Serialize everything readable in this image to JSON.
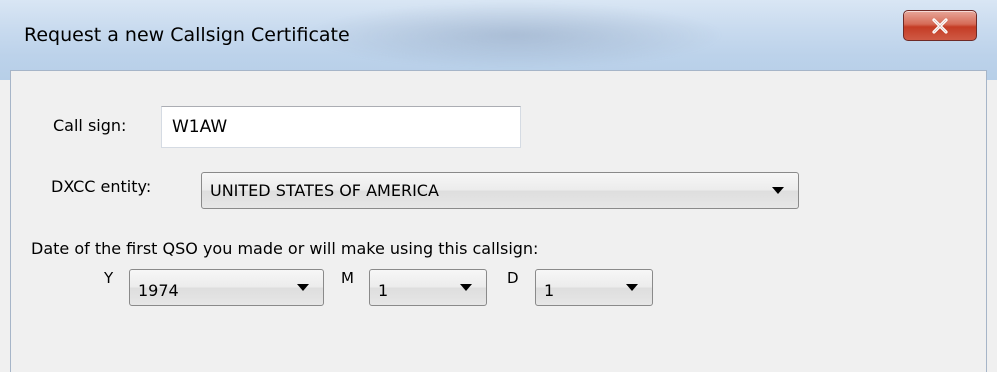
{
  "window": {
    "title": "Request a new Callsign Certificate",
    "close_label": "✕"
  },
  "form": {
    "callsign_label": "Call sign:",
    "callsign_value": "W1AW",
    "dxcc_label": "DXCC entity:",
    "dxcc_value": "UNITED STATES OF AMERICA",
    "date_prompt": "Date of the first QSO you made or will make using this callsign:",
    "year_label": "Y",
    "year_value": "1974",
    "month_label": "M",
    "month_value": "1",
    "day_label": "D",
    "day_value": "1"
  },
  "icons": {
    "close": "close-icon",
    "dropdown": "chevron-down-icon"
  }
}
